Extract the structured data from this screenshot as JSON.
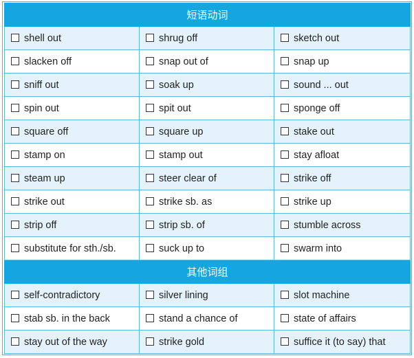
{
  "sections": [
    {
      "title": "短语动词",
      "rows": [
        [
          "shell out",
          "shrug off",
          "sketch out"
        ],
        [
          "slacken off",
          "snap out of",
          "snap up"
        ],
        [
          "sniff out",
          "soak up",
          "sound ... out"
        ],
        [
          "spin out",
          "spit out",
          "sponge off"
        ],
        [
          "square off",
          "square up",
          "stake out"
        ],
        [
          "stamp on",
          "stamp out",
          "stay afloat"
        ],
        [
          "steam up",
          "steer clear of",
          "strike off"
        ],
        [
          "strike out",
          "strike sb. as",
          "strike up"
        ],
        [
          "strip off",
          "strip sb. of",
          "stumble across"
        ],
        [
          "substitute for sth./sb.",
          "suck up to",
          "swarm into"
        ]
      ]
    },
    {
      "title": "其他词组",
      "rows": [
        [
          "self-contradictory",
          "silver lining",
          "slot machine"
        ],
        [
          "stab sb. in the back",
          "stand a chance of",
          "state of affairs"
        ],
        [
          "stay out of the way",
          "strike gold",
          "suffice it (to say) that"
        ]
      ]
    }
  ],
  "colors": {
    "header": "#14a6e0",
    "alt_row": "#e4f3fb",
    "border": "#5bb8dc"
  }
}
